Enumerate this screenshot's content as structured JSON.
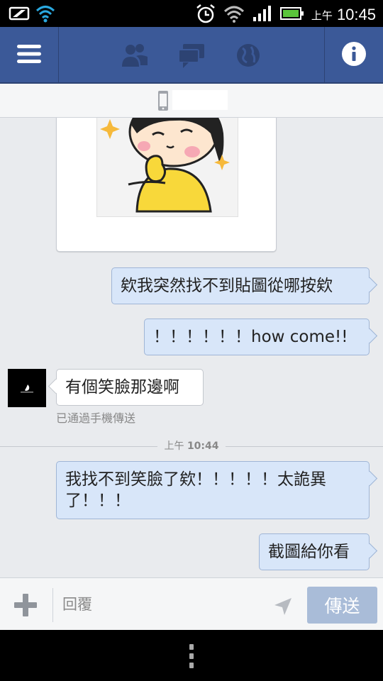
{
  "status_bar": {
    "ampm": "上午",
    "time": "10:45"
  },
  "topbar": {
    "icons": [
      "menu-icon",
      "friend-requests-icon",
      "messages-icon",
      "notifications-globe-icon",
      "info-icon"
    ]
  },
  "conversation": {
    "title": ""
  },
  "messages": [
    {
      "direction": "out",
      "text": "欸我突然找不到貼圖從哪按欸"
    },
    {
      "direction": "out",
      "text": "！！！！！！how come!!"
    },
    {
      "direction": "in",
      "text": "有個笑臉那邊啊",
      "meta": "已通過手機傳送"
    },
    {
      "direction": "out",
      "text": "我找不到笑臉了欸！！！！！太詭異了！！！"
    },
    {
      "direction": "out",
      "text": "截圖給你看"
    }
  ],
  "divider": {
    "ampm": "上午",
    "time": "10:44"
  },
  "composer": {
    "placeholder": "回覆",
    "send_label": "傳送"
  },
  "colors": {
    "brand": "#3b5998",
    "outgoing_bubble": "#d8e6f9",
    "send_button": "#a9bcd8"
  }
}
